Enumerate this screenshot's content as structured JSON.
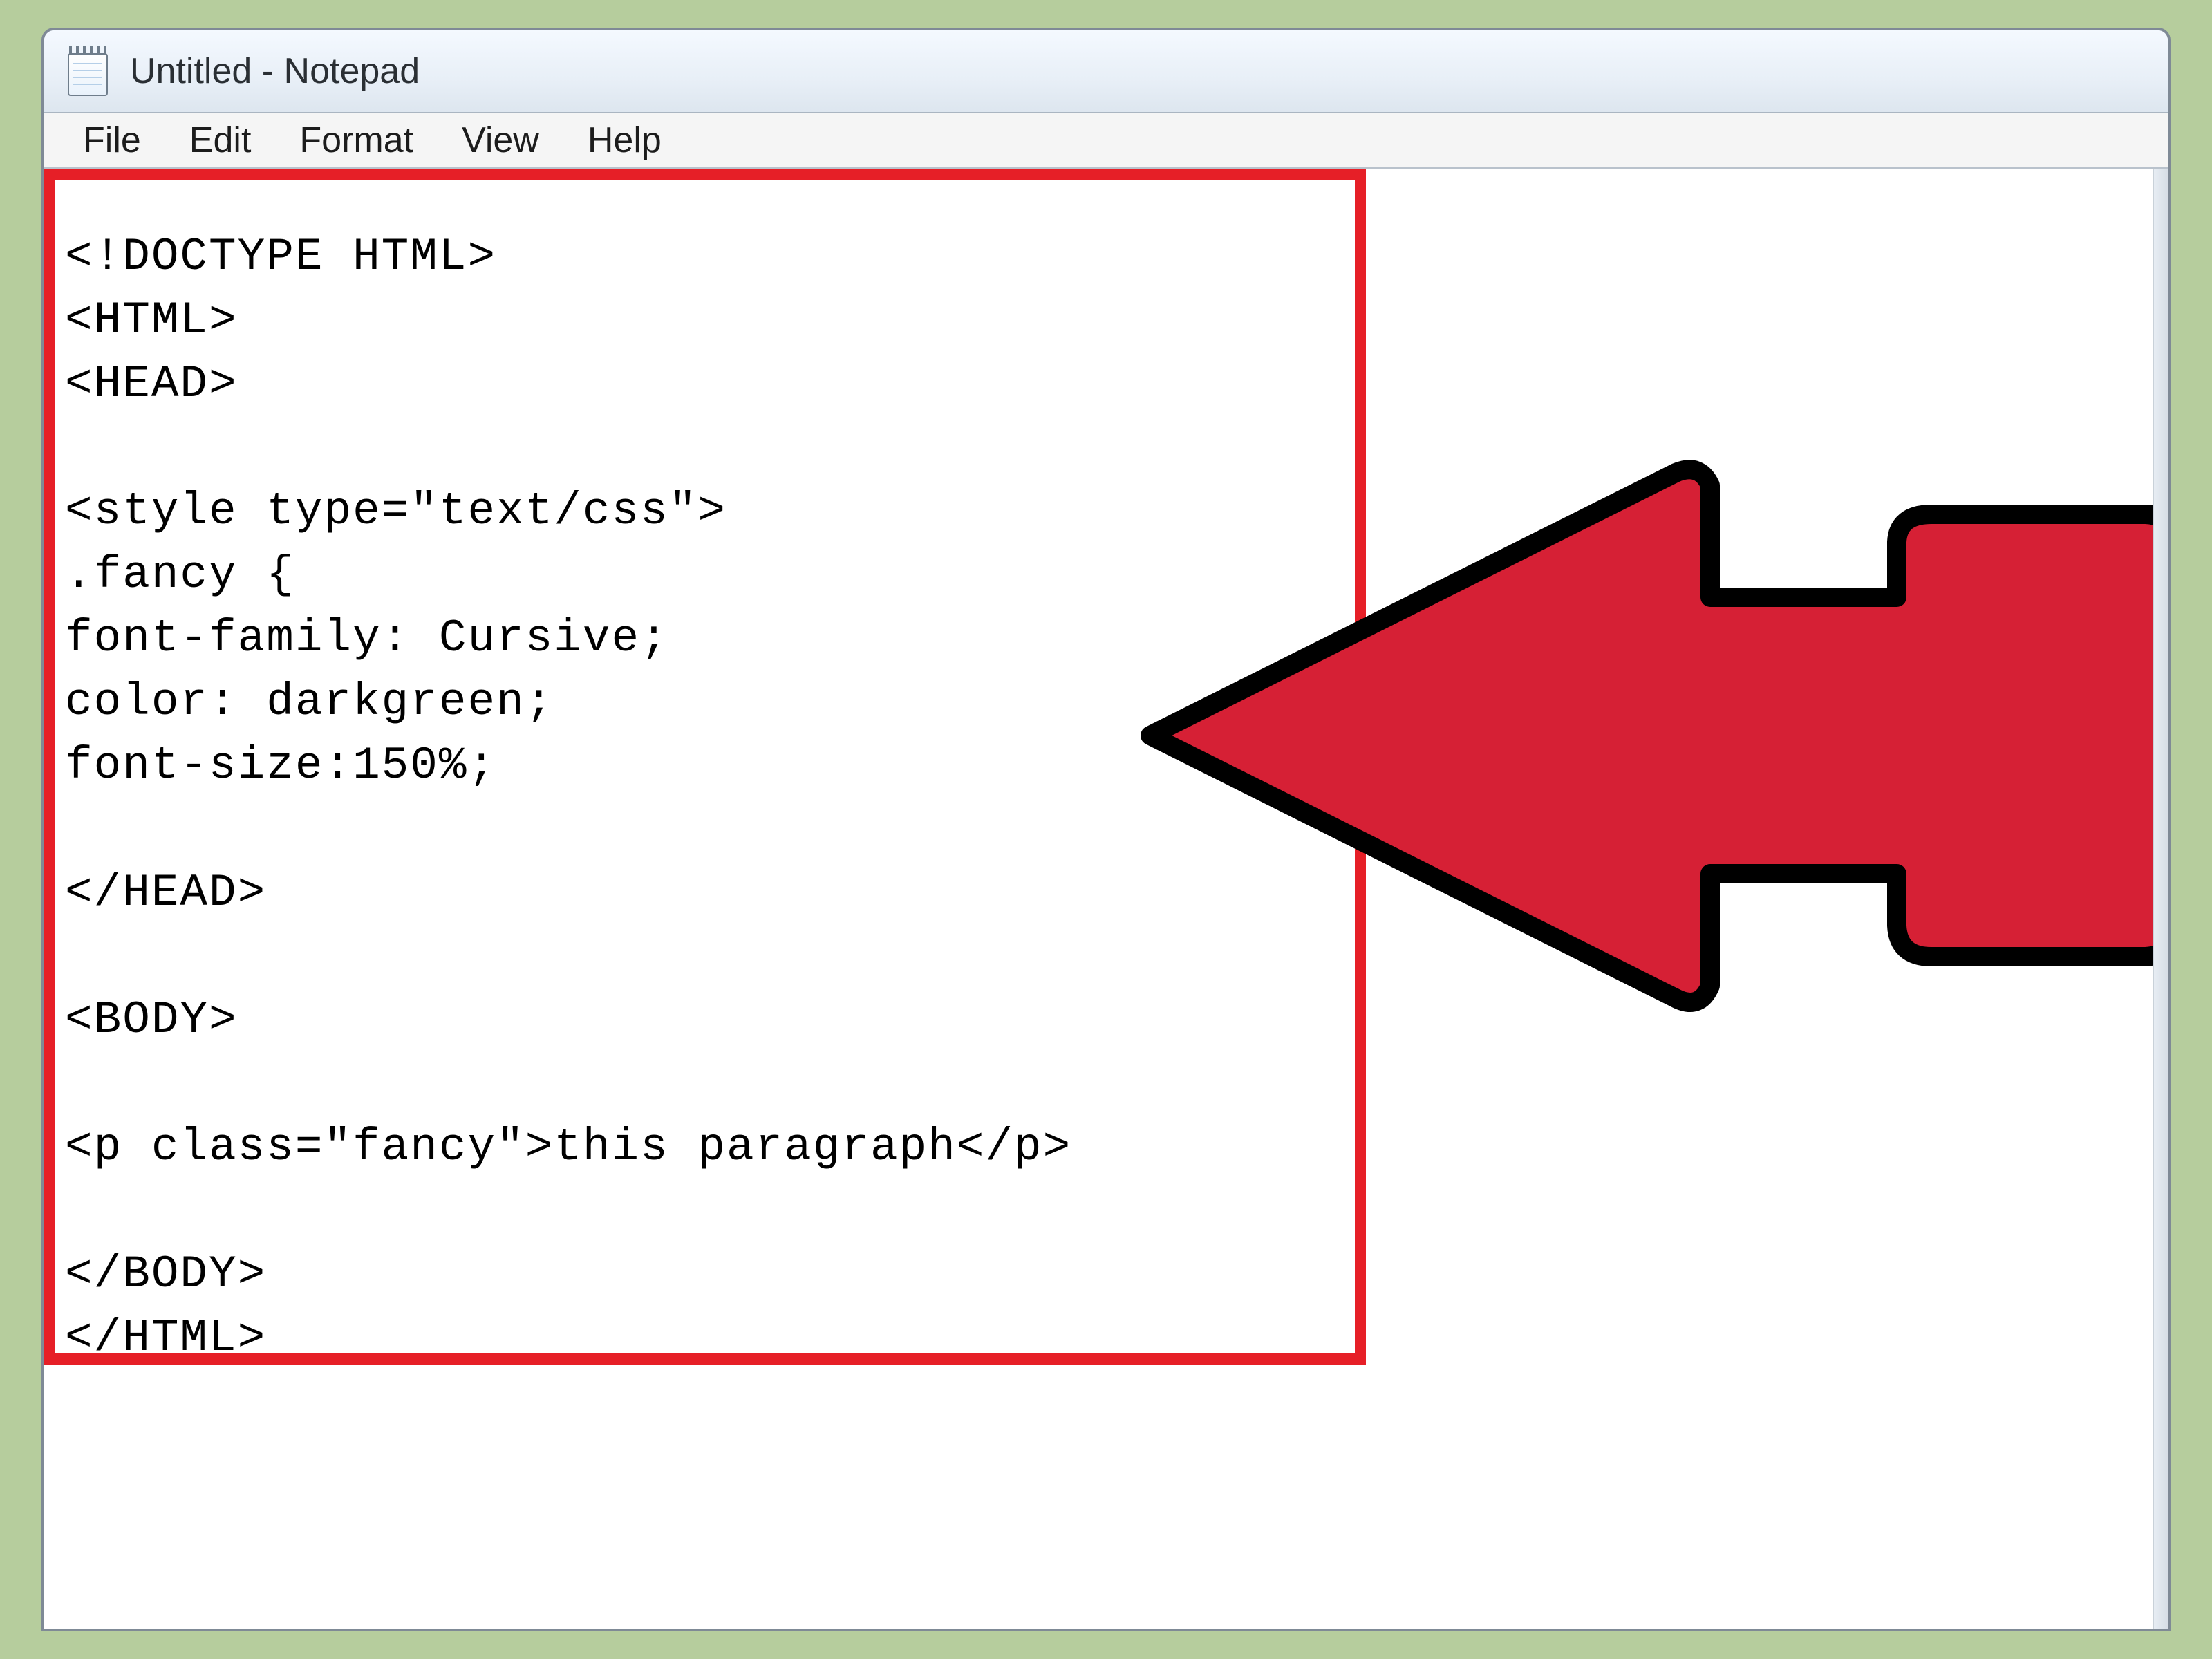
{
  "window": {
    "title": "Untitled - Notepad"
  },
  "menu": {
    "items": [
      {
        "label": "File"
      },
      {
        "label": "Edit"
      },
      {
        "label": "Format"
      },
      {
        "label": "View"
      },
      {
        "label": "Help"
      }
    ]
  },
  "editor": {
    "content": "<!DOCTYPE HTML>\n<HTML>\n<HEAD>\n\n<style type=\"text/css\">\n.fancy {\nfont-family: Cursive;\ncolor: darkgreen;\nfont-size:150%;\n\n</HEAD>\n\n<BODY>\n\n<p class=\"fancy\">this paragraph</p>\n\n</BODY>\n</HTML>"
  },
  "annotations": {
    "highlight_color": "#e61f27",
    "arrow_fill": "#d62035",
    "arrow_stroke": "#000000"
  }
}
